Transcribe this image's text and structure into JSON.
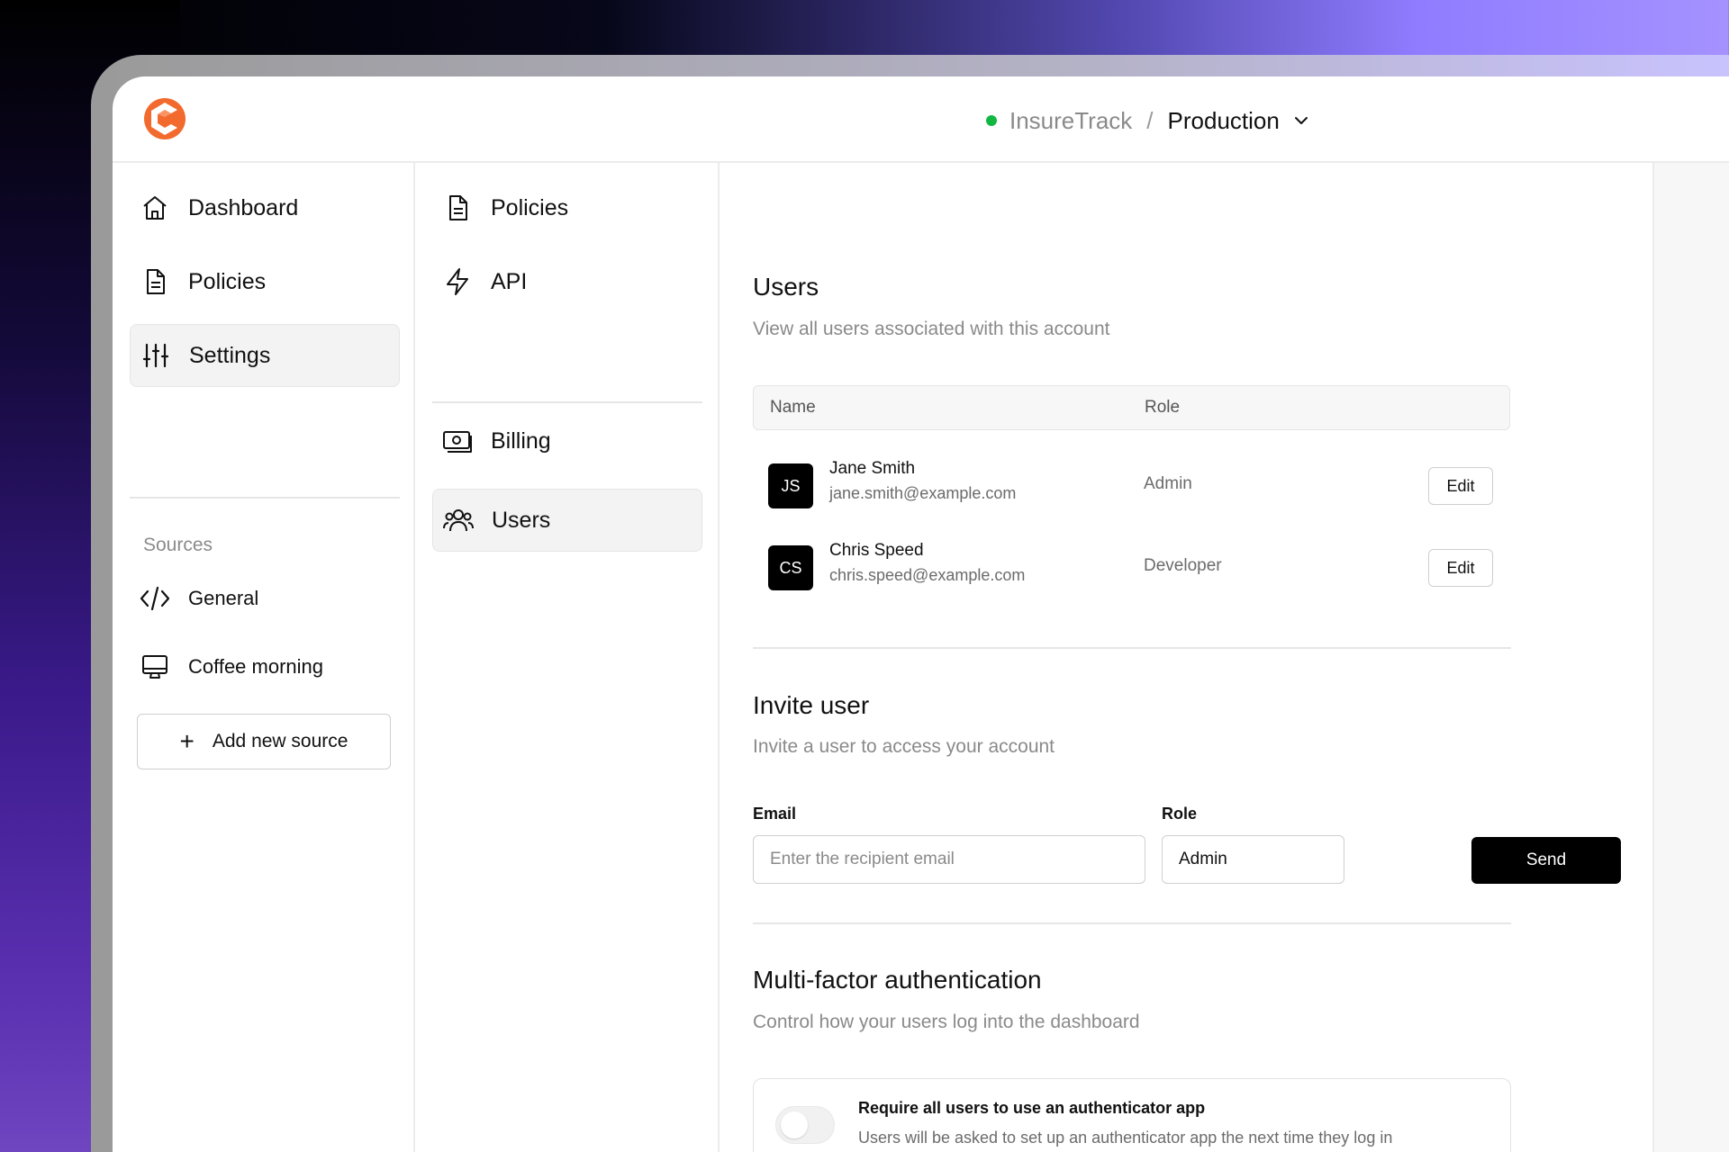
{
  "breadcrumb": {
    "org": "InsureTrack",
    "separator": "/",
    "environment": "Production",
    "status_color": "#12b742"
  },
  "brand": {
    "logo_icon": "brand-logo-icon",
    "accent": "#f26a2e"
  },
  "sidebar": {
    "items": [
      {
        "label": "Dashboard",
        "icon": "home-icon"
      },
      {
        "label": "Policies",
        "icon": "document-icon"
      },
      {
        "label": "Settings",
        "icon": "sliders-icon",
        "active": true
      }
    ],
    "sources_label": "Sources",
    "sources": [
      {
        "label": "General",
        "icon": "code-icon"
      },
      {
        "label": "Coffee morning",
        "icon": "monitor-icon"
      }
    ],
    "add_source_label": "Add new source"
  },
  "settings_nav": {
    "items": [
      {
        "label": "Policies",
        "icon": "document-icon"
      },
      {
        "label": "API",
        "icon": "lightning-icon"
      },
      {
        "label": "Billing",
        "icon": "money-icon"
      },
      {
        "label": "Users",
        "icon": "users-icon",
        "active": true
      }
    ]
  },
  "users": {
    "title": "Users",
    "subtitle": "View all users associated with this account",
    "columns": [
      "Name",
      "Role"
    ],
    "rows": [
      {
        "initials": "JS",
        "name": "Jane Smith",
        "email": "jane.smith@example.com",
        "role": "Admin",
        "action": "Edit"
      },
      {
        "initials": "CS",
        "name": "Chris Speed",
        "email": "chris.speed@example.com",
        "role": "Developer",
        "action": "Edit"
      }
    ]
  },
  "invite": {
    "title": "Invite user",
    "subtitle": "Invite a user to access your account",
    "email_label": "Email",
    "email_placeholder": "Enter the recipient email",
    "role_label": "Role",
    "role_value": "Admin",
    "send_label": "Send"
  },
  "mfa": {
    "title": "Multi-factor authentication",
    "subtitle": "Control how your users log into the dashboard",
    "option_title": "Require all users to use an authenticator app",
    "option_desc": "Users will be asked to set up an authenticator app the next time they log in",
    "enabled": false
  }
}
